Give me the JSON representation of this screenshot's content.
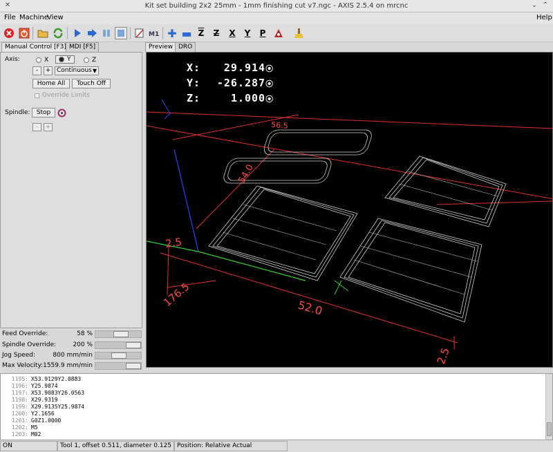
{
  "window": {
    "title": "Kit set building 2x2 25mm - 1mm finishing cut v7.ngc - AXIS 2.5.4 on mrcnc"
  },
  "menu": {
    "file": "File",
    "machine": "Machine",
    "view": "View",
    "help": "Help"
  },
  "toolbar": {
    "icons": [
      "estop-icon",
      "power-icon",
      "open-icon",
      "reload-icon",
      "run-icon",
      "step-icon",
      "pause-icon",
      "stop-icon",
      "block-delete-icon",
      "optional-stop-icon",
      "zoom-in-icon",
      "zoom-out-icon",
      "view-z-icon",
      "view-z2-icon",
      "view-x-icon",
      "view-y-icon",
      "view-p-icon",
      "rotate-icon",
      "clear-plot-icon"
    ],
    "labels": {
      "z": "Z",
      "x": "X",
      "y": "Y",
      "p": "P"
    }
  },
  "left_tabs": {
    "manual": "Manual Control [F3]",
    "mdi": "MDI [F5]"
  },
  "manual": {
    "axis_label": "Axis:",
    "axes": [
      "X",
      "Y",
      "Z"
    ],
    "selected_axis": "Y",
    "jog_minus": "-",
    "jog_plus": "+",
    "jog_mode": "Continuous",
    "home_all": "Home All",
    "touch_off": "Touch Off",
    "override_limits": "Override Limits",
    "spindle_label": "Spindle:",
    "spindle_stop": "Stop",
    "spindle_minus": "-",
    "spindle_plus": "+"
  },
  "overrides": [
    {
      "label": "Feed Override:",
      "value": "58 %",
      "fraction": 0.58
    },
    {
      "label": "Spindle Override:",
      "value": "200 %",
      "fraction": 1.0
    },
    {
      "label": "Jog Speed:",
      "value": "800 mm/min",
      "fraction": 0.52
    },
    {
      "label": "Max Velocity:",
      "value": "1559.9 mm/min",
      "fraction": 1.0
    }
  ],
  "right_tabs": {
    "preview": "Preview",
    "dro": "DRO"
  },
  "dro": [
    {
      "axis": "X:",
      "value": "29.914"
    },
    {
      "axis": "Y:",
      "value": "-26.287"
    },
    {
      "axis": "Z:",
      "value": "1.000"
    }
  ],
  "dims": {
    "d1": "56.5",
    "d2": "54.0",
    "d3": "2.5",
    "d4": "176.5",
    "d5": "52.0",
    "d6": "2.5"
  },
  "gcode": [
    {
      "n": "1195:",
      "code": "X53.9129Y2.0883"
    },
    {
      "n": "1196:",
      "code": "Y25.9874"
    },
    {
      "n": "1197:",
      "code": "X53.9083Y26.0563"
    },
    {
      "n": "1198:",
      "code": "X29.9319"
    },
    {
      "n": "1199:",
      "code": "X29.9135Y25.9874"
    },
    {
      "n": "1200:",
      "code": "Y2.1656"
    },
    {
      "n": "1201:",
      "code": "G0Z1.0000"
    },
    {
      "n": "1202:",
      "code": "M5"
    },
    {
      "n": "1203:",
      "code": "M02"
    }
  ],
  "status": {
    "state": "ON",
    "tool": "Tool 1, offset 0.511, diameter 0.125",
    "position": "Position: Relative Actual"
  },
  "colors": {
    "extent": "#ff3030",
    "x_axis": "#ff3030",
    "y_axis": "#30e030",
    "z_axis": "#3040ff",
    "toolpath": "#d8d8d8"
  }
}
